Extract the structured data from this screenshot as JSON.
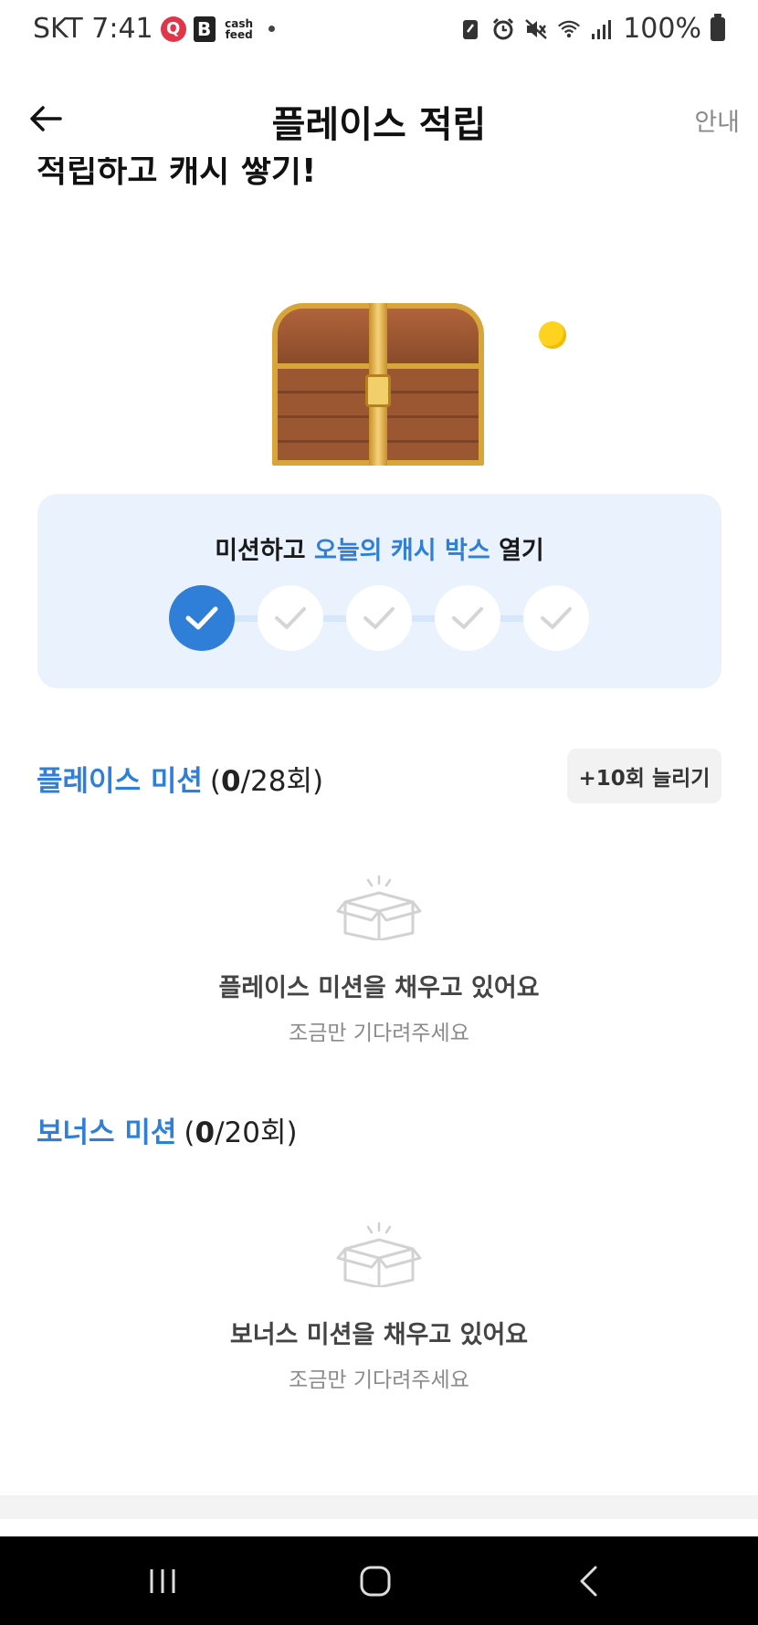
{
  "status_bar": {
    "carrier_time": "SKT 7:41",
    "app_q": "Q",
    "app_b": "B",
    "app_cashfeed": "cash feed",
    "battery_percent": "100%"
  },
  "header": {
    "title": "플레이스 적립",
    "info_label": "안내"
  },
  "headline": "적립하고 캐시 쌓기!",
  "cash_box": {
    "title_prefix": "미션하고 ",
    "title_accent": "오늘의 캐시 박스",
    "title_suffix": " 열기",
    "steps_total": 5,
    "steps_completed": 1
  },
  "place_mission": {
    "name": "플레이스 미션",
    "count_open": "(",
    "count_done": "0",
    "count_rest": "/28회)",
    "expand_label": "+10회 늘리기",
    "empty_title": "플레이스 미션을 채우고 있어요",
    "empty_sub": "조금만 기다려주세요"
  },
  "bonus_mission": {
    "name": "보너스 미션",
    "count_open": "(",
    "count_done": "0",
    "count_rest": "/20회)",
    "empty_title": "보너스 미션을 채우고 있어요",
    "empty_sub": "조금만 기다려주세요"
  },
  "colors": {
    "accent": "#2f7fd8",
    "card_bg": "#eaf2fd"
  }
}
